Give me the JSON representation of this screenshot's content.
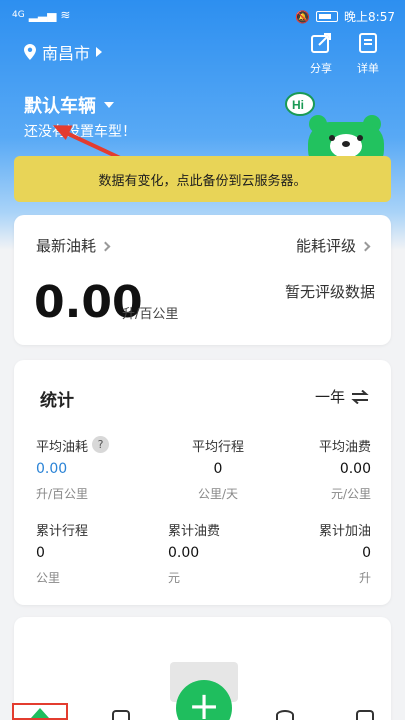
{
  "status_bar": {
    "signal": "4G",
    "time": "晚上8:57"
  },
  "header": {
    "city": "南昌市",
    "share_label": "分享",
    "detail_label": "详单"
  },
  "vehicle": {
    "title": "默认车辆",
    "subtitle": "还没有设置车型！",
    "mascot_bubble": "Hi"
  },
  "notice": {
    "text": "数据有变化，点此备份到云服务器。"
  },
  "consumption_card": {
    "latest_label": "最新油耗",
    "rating_label": "能耗评级",
    "value": "0.00",
    "unit": "升/百公里",
    "no_rating": "暂无评级数据"
  },
  "stats": {
    "title": "统计",
    "period": "一年",
    "items": [
      {
        "label": "平均油耗",
        "value": "0.00",
        "unit": "升/百公里"
      },
      {
        "label": "平均行程",
        "value": "0",
        "unit": "公里/天"
      },
      {
        "label": "平均油费",
        "value": "0.00",
        "unit": "元/公里"
      },
      {
        "label": "累计行程",
        "value": "0",
        "unit": "公里"
      },
      {
        "label": "累计油费",
        "value": "0.00",
        "unit": "元"
      },
      {
        "label": "累计加油",
        "value": "0",
        "unit": "升"
      }
    ],
    "help": "?"
  },
  "fab": {
    "label": "+"
  },
  "colors": {
    "primary_blue": "#2d8ff0",
    "accent_green": "#1fbe5e",
    "notice_yellow": "#e8d457",
    "annotation_red": "#e33c2f"
  }
}
